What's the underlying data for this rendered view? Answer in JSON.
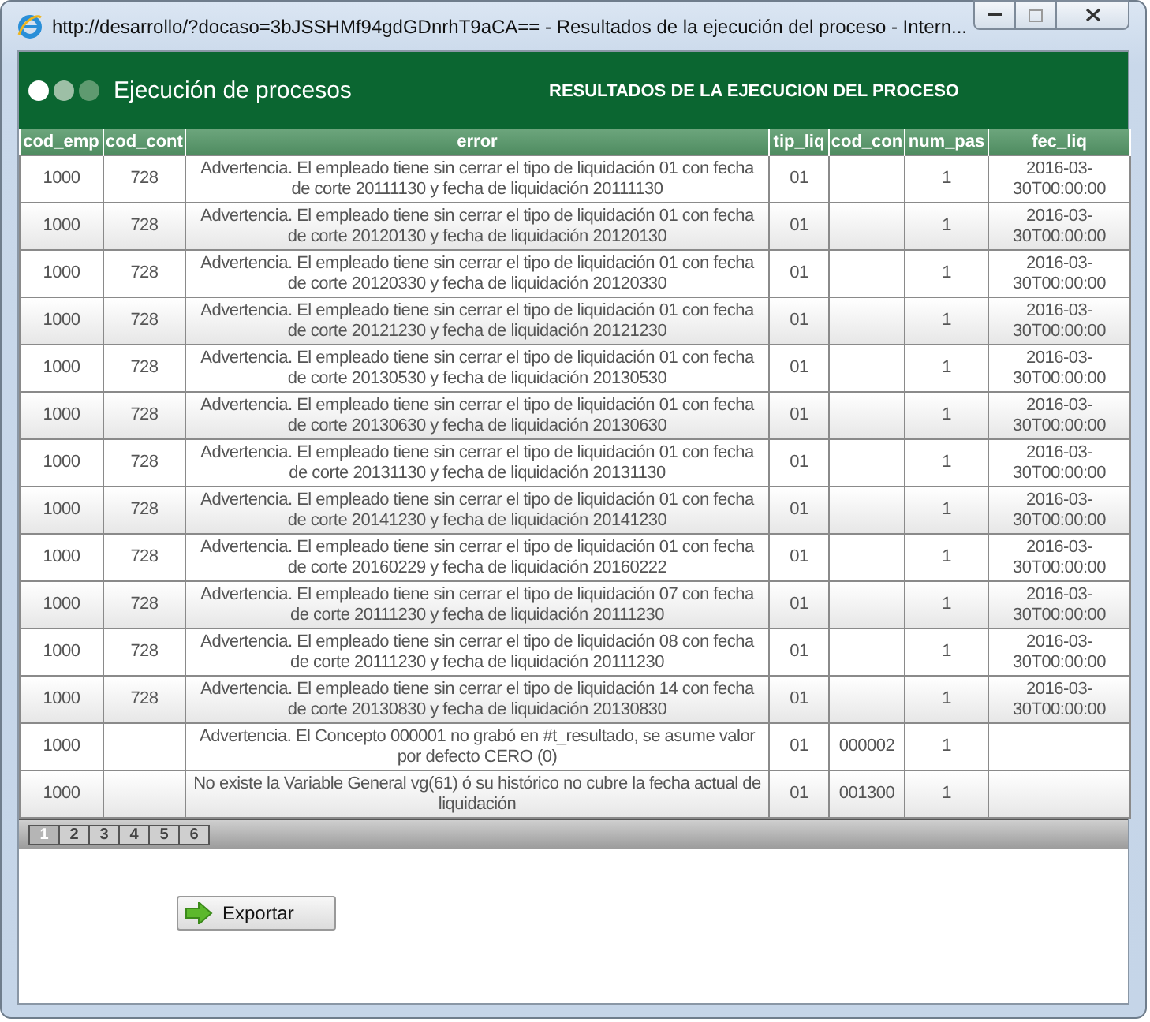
{
  "window": {
    "title": "http://desarrollo/?docaso=3bJSSHMf94gdGDnrhT9aCA== - Resultados de la ejecución del proceso - Intern..."
  },
  "header": {
    "app_title": "Ejecución de procesos",
    "page_title": "RESULTADOS DE LA EJECUCION DEL PROCESO"
  },
  "table": {
    "columns": [
      "cod_emp",
      "cod_cont",
      "error",
      "tip_liq",
      "cod_con",
      "num_pas",
      "fec_liq"
    ],
    "rows": [
      [
        "1000",
        "728",
        "Advertencia. El empleado tiene sin cerrar el tipo de liquidación 01 con fecha de corte 20111130 y fecha de liquidación 20111130",
        "01",
        "",
        "1",
        "2016-03-30T00:00:00"
      ],
      [
        "1000",
        "728",
        "Advertencia. El empleado tiene sin cerrar el tipo de liquidación 01 con fecha de corte 20120130 y fecha de liquidación 20120130",
        "01",
        "",
        "1",
        "2016-03-30T00:00:00"
      ],
      [
        "1000",
        "728",
        "Advertencia. El empleado tiene sin cerrar el tipo de liquidación 01 con fecha de corte 20120330 y fecha de liquidación 20120330",
        "01",
        "",
        "1",
        "2016-03-30T00:00:00"
      ],
      [
        "1000",
        "728",
        "Advertencia. El empleado tiene sin cerrar el tipo de liquidación 01 con fecha de corte 20121230 y fecha de liquidación 20121230",
        "01",
        "",
        "1",
        "2016-03-30T00:00:00"
      ],
      [
        "1000",
        "728",
        "Advertencia. El empleado tiene sin cerrar el tipo de liquidación 01 con fecha de corte 20130530 y fecha de liquidación 20130530",
        "01",
        "",
        "1",
        "2016-03-30T00:00:00"
      ],
      [
        "1000",
        "728",
        "Advertencia. El empleado tiene sin cerrar el tipo de liquidación 01 con fecha de corte 20130630 y fecha de liquidación 20130630",
        "01",
        "",
        "1",
        "2016-03-30T00:00:00"
      ],
      [
        "1000",
        "728",
        "Advertencia. El empleado tiene sin cerrar el tipo de liquidación 01 con fecha de corte 20131130 y fecha de liquidación 20131130",
        "01",
        "",
        "1",
        "2016-03-30T00:00:00"
      ],
      [
        "1000",
        "728",
        "Advertencia. El empleado tiene sin cerrar el tipo de liquidación 01 con fecha de corte 20141230 y fecha de liquidación 20141230",
        "01",
        "",
        "1",
        "2016-03-30T00:00:00"
      ],
      [
        "1000",
        "728",
        "Advertencia. El empleado tiene sin cerrar el tipo de liquidación 01 con fecha de corte 20160229 y fecha de liquidación 20160222",
        "01",
        "",
        "1",
        "2016-03-30T00:00:00"
      ],
      [
        "1000",
        "728",
        "Advertencia. El empleado tiene sin cerrar el tipo de liquidación 07 con fecha de corte 20111230 y fecha de liquidación 20111230",
        "01",
        "",
        "1",
        "2016-03-30T00:00:00"
      ],
      [
        "1000",
        "728",
        "Advertencia. El empleado tiene sin cerrar el tipo de liquidación 08 con fecha de corte 20111230 y fecha de liquidación 20111230",
        "01",
        "",
        "1",
        "2016-03-30T00:00:00"
      ],
      [
        "1000",
        "728",
        "Advertencia. El empleado tiene sin cerrar el tipo de liquidación 14 con fecha de corte 20130830 y fecha de liquidación 20130830",
        "01",
        "",
        "1",
        "2016-03-30T00:00:00"
      ],
      [
        "1000",
        "",
        "Advertencia. El Concepto 000001 no grabó en #t_resultado, se asume valor por defecto CERO (0)",
        "01",
        "000002",
        "1",
        ""
      ],
      [
        "1000",
        "",
        "No existe la Variable General vg(61) ó su histórico no cubre la fecha actual de liquidación",
        "01",
        "001300",
        "1",
        ""
      ]
    ]
  },
  "pager": [
    {
      "label": "1",
      "selected": true
    },
    {
      "label": "2",
      "selected": false
    },
    {
      "label": "3",
      "selected": false
    },
    {
      "label": "4",
      "selected": false
    },
    {
      "label": "5",
      "selected": false
    },
    {
      "label": "6",
      "selected": false
    }
  ],
  "export_button": {
    "label": "Exportar"
  }
}
